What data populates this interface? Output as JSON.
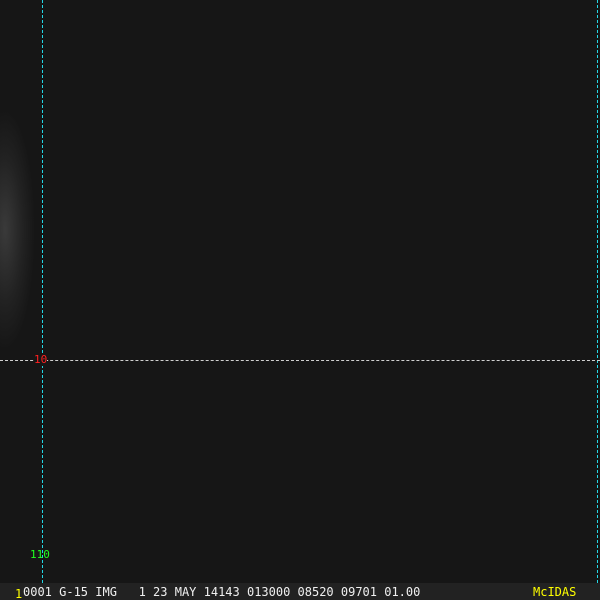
{
  "overlay": {
    "lat_label": "10",
    "lon_label": "110",
    "line_colors": {
      "lon": "#22d8e6",
      "lat": "#d0d0d0"
    }
  },
  "status_bar": {
    "frame_number": "1",
    "image_info": "0001 G-15 IMG   1 23 MAY 14143 013000 08520 09701 01.00",
    "brand": "McIDAS"
  }
}
